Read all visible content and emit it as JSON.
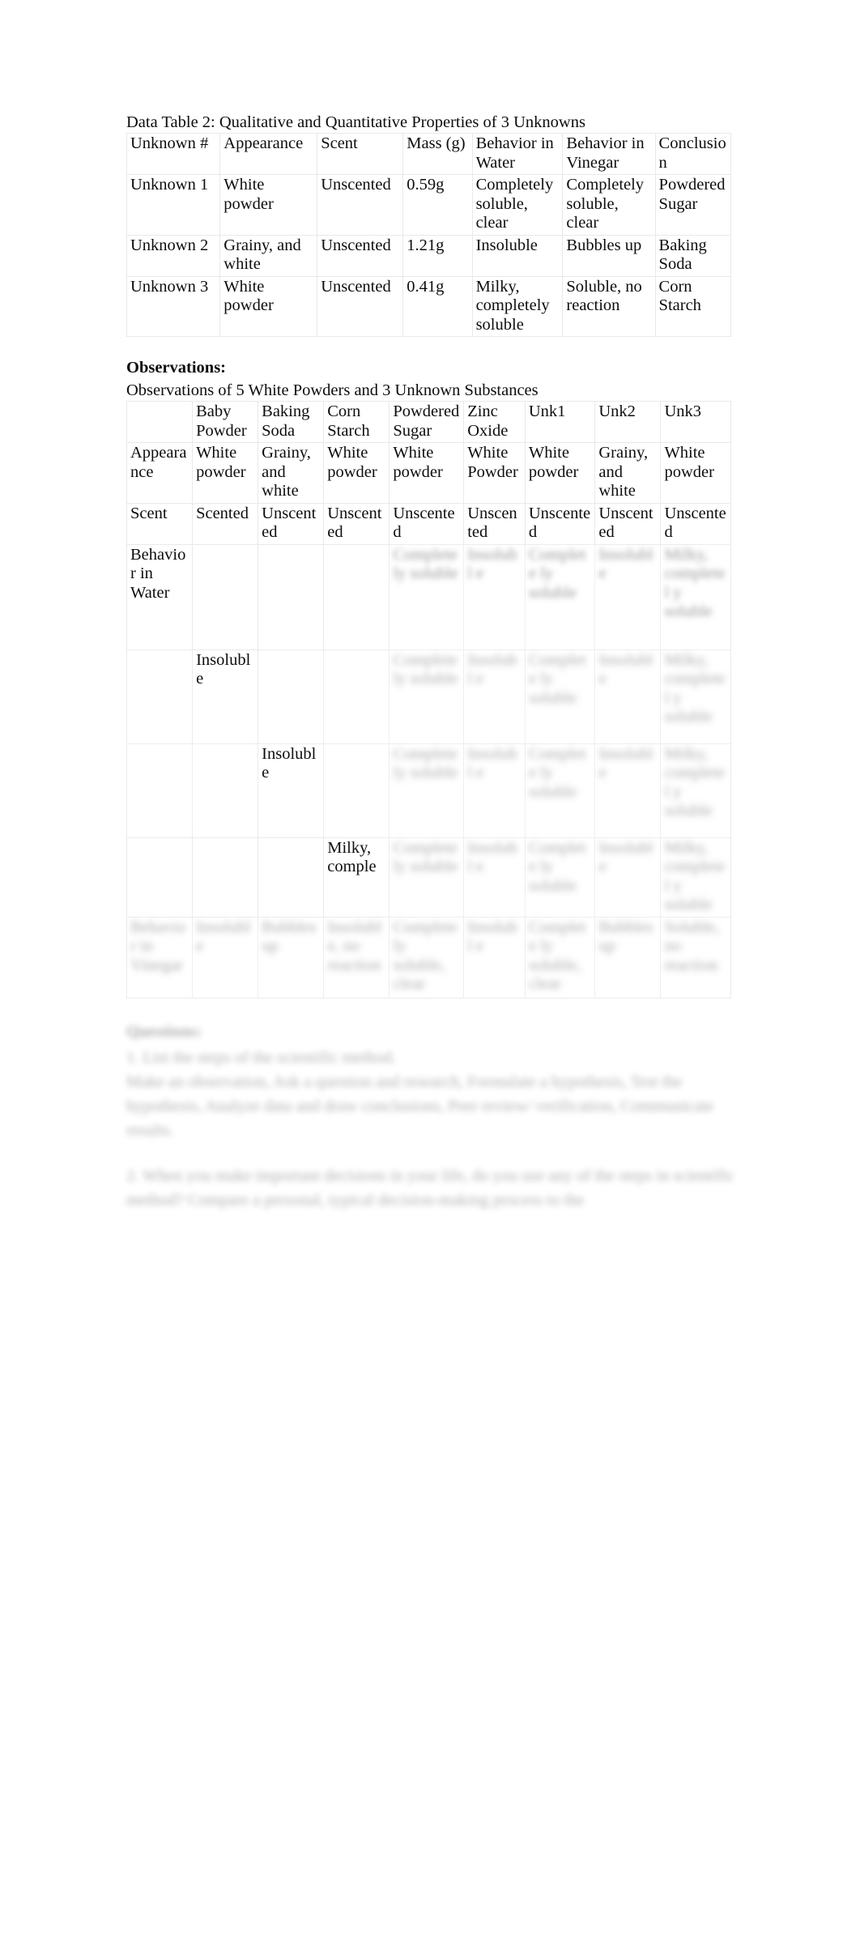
{
  "document": {
    "table1": {
      "caption": "Data Table 2: Qualitative and Quantitative Properties of 3 Unknowns",
      "headers": [
        "Unknown #",
        "Appearance",
        "Scent",
        "Mass (g)",
        "Behavior in Water",
        "Behavior in Vinegar",
        "Conclusion"
      ],
      "rows": [
        {
          "unknown": "Unknown 1",
          "appearance": "White powder",
          "scent": "Unscented",
          "mass": "0.59g",
          "water": "Completely soluble, clear",
          "vinegar": "Completely soluble, clear",
          "conclusion": "Powdered Sugar"
        },
        {
          "unknown": "Unknown 2",
          "appearance": "Grainy, and white",
          "scent": "Unscented",
          "mass": "1.21g",
          "water": "Insoluble",
          "vinegar": "Bubbles up",
          "conclusion": "Baking Soda"
        },
        {
          "unknown": "Unknown 3",
          "appearance": "White powder",
          "scent": "Unscented",
          "mass": "0.41g",
          "water": "Milky, completely soluble",
          "vinegar": "Soluble, no reaction",
          "conclusion": "Corn Starch"
        }
      ]
    },
    "observations": {
      "heading": "Observations:",
      "caption": "Observations of 5 White Powders and 3 Unknown Substances",
      "headers": [
        "",
        "Baby Powder",
        "Baking Soda",
        "Corn Starch",
        "Powdered Sugar",
        "Zinc Oxide",
        "Unk1",
        "Unk2",
        "Unk3"
      ],
      "rows": [
        {
          "label": "Appearance",
          "cells": [
            "White powder",
            "Grainy, and white",
            "White powder",
            "White powder",
            "White Powder",
            "White powder",
            "Grainy, and white",
            "White powder"
          ]
        },
        {
          "label": "Scent",
          "cells": [
            "Scented",
            "Unscented",
            "Unscented",
            "Unscented",
            "Unscented",
            "Unscented",
            "Unscented",
            "Unscented"
          ]
        },
        {
          "label": "Behavior in Water",
          "cells": [
            "",
            "",
            "",
            "Complete ly soluble",
            "Insolubl e",
            "Complete ly soluble",
            "Insolubl e",
            "Milky, completel y soluble"
          ]
        },
        {
          "label": "",
          "cells": [
            "Insoluble",
            "",
            "",
            "Complete ly soluble",
            "Insolubl e",
            "Complete ly soluble",
            "Insolubl e",
            "Milky, completel y soluble"
          ]
        },
        {
          "label": "",
          "cells": [
            "",
            "Insoluble",
            "",
            "Complete ly soluble",
            "Insolubl e",
            "Complete ly soluble",
            "Insolubl e",
            "Milky, completel y soluble"
          ]
        },
        {
          "label": "",
          "cells": [
            "",
            "",
            "Milky, comple",
            "Complete ly soluble",
            "Insolubl e",
            "Complete ly soluble",
            "Insolubl e",
            "Milky, completel y soluble"
          ]
        },
        {
          "label": "Behavior in Vinegar",
          "cells": [
            "Insolubl e",
            "Bubbles up",
            "Insolubl e, no reaction",
            "Complete ly soluble, clear",
            "Insolubl e",
            "Complete ly soluble, clear",
            "Bubbles up",
            "Soluble, no reaction"
          ]
        }
      ]
    },
    "questions": {
      "heading": "Questions:",
      "items": [
        "1. List the steps of the scientific method.",
        "Make an observation, Ask a question and research, Formulate a hypothesis, Test the hypothesis, Analyze data and draw conclusions, Peer review/ verification, Communicate results.",
        "2. When you make important decisions in your life, do you use any of the steps in scientific method? Compare a personal, typical decision-making process to the"
      ]
    }
  }
}
